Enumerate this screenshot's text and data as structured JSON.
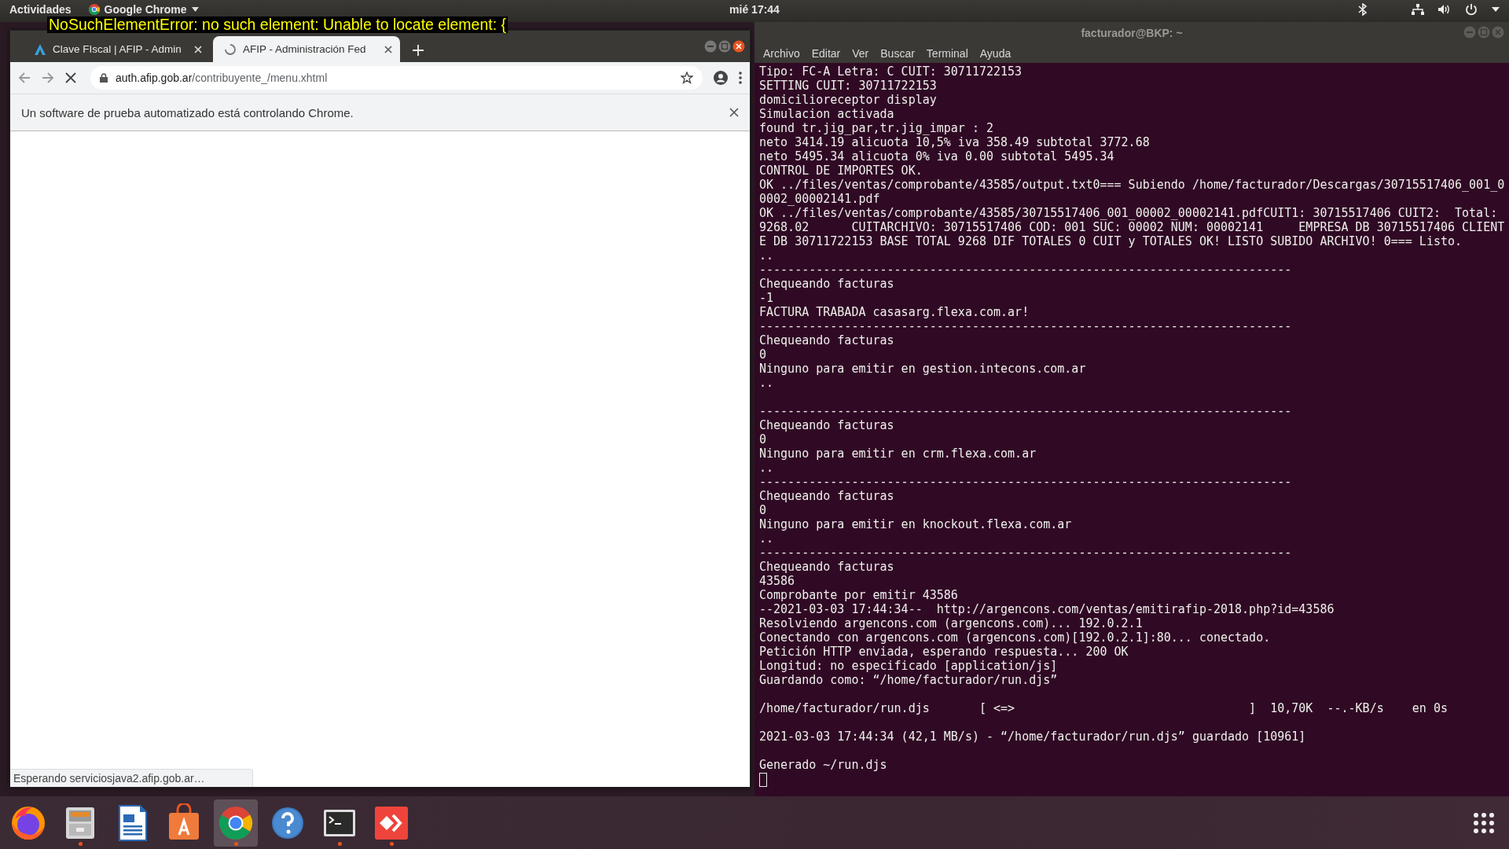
{
  "top_bar": {
    "activities": "Actividades",
    "app_menu": "Google Chrome",
    "clock": "mié 17:44"
  },
  "overlay": {
    "text": "NoSuchElementError: no such element: Unable to locate element: {"
  },
  "browser": {
    "tabs": [
      {
        "title": "Clave FIscal | AFIP - Admin",
        "selected": false,
        "loading": false
      },
      {
        "title": "AFIP - Administración Fed",
        "selected": true,
        "loading": true
      }
    ],
    "address": {
      "host": "auth.afip.gob.ar",
      "path": "/contribuyente_/menu.xhtml"
    },
    "infobar": "Un software de prueba automatizado está controlando Chrome.",
    "status": "Esperando serviciosjava2.afip.gob.ar…"
  },
  "terminal": {
    "title": "facturador@BKP: ~",
    "menu": [
      "Archivo",
      "Editar",
      "Ver",
      "Buscar",
      "Terminal",
      "Ayuda"
    ],
    "blocks": [
      {
        "lines": [
          "Tipo: FC-A Letra: C CUIT: 30711722153",
          "SETTING CUIT: 30711722153",
          "domicilioreceptor display",
          "Simulacion activada",
          "found tr.jig_par,tr.jig_impar : 2",
          "neto 3414.19 alicuota 10,5% iva 358.49 subtotal 3772.68",
          "neto 5495.34 alicuota 0% iva 0.00 subtotal 5495.34",
          "CONTROL DE IMPORTES OK.",
          "OK ../files/ventas/comprobante/43585/output.txt0=== Subiendo /home/facturador/Descargas/30715517406_001_0",
          "0002_00002141.pdf",
          "OK ../files/ventas/comprobante/43585/30715517406_001_00002_00002141.pdfCUIT1: 30715517406 CUIT2:  Total:",
          "9268.02      CUITARCHIVO: 30715517406 COD: 001 SUC: 00002 NUM: 00002141     EMPRESA DB 30715517406 CLIENT",
          "E DB 30711722153 BASE TOTAL 9268 DIF TOTALES 0 CUIT y TOTALES OK! LISTO SUBIDO ARCHIVO! 0=== Listo.",
          "..",
          "---------------------------------------------------------------------------",
          "Chequeando facturas",
          "-1",
          "FACTURA TRABADA casasarg.flexa.com.ar!",
          "---------------------------------------------------------------------------",
          "Chequeando facturas",
          "0",
          "Ninguno para emitir en gestion.intecons.com.ar",
          ".."
        ]
      },
      {
        "lines": [
          "---------------------------------------------------------------------------",
          "Chequeando facturas",
          "0",
          "Ninguno para emitir en crm.flexa.com.ar",
          "..",
          "---------------------------------------------------------------------------",
          "Chequeando facturas",
          "0",
          "Ninguno para emitir en knockout.flexa.com.ar",
          "..",
          "---------------------------------------------------------------------------",
          "Chequeando facturas",
          "43586",
          "Comprobante por emitir 43586",
          "--2021-03-03 17:44:34--  http://argencons.com/ventas/emitirafip-2018.php?id=43586",
          "Resolviendo argencons.com (argencons.com)... 192.0.2.1",
          "Conectando con argencons.com (argencons.com)[192.0.2.1]:80... conectado.",
          "Petición HTTP enviada, esperando respuesta... 200 OK",
          "Longitud: no especificado [application/js]",
          "Guardando como: “/home/facturador/run.djs”"
        ]
      },
      {
        "lines": [
          "/home/facturador/run.djs       [ <=>                                 ]  10,70K  --.-KB/s    en 0s"
        ]
      },
      {
        "lines": [
          "2021-03-03 17:44:34 (42,1 MB/s) - “/home/facturador/run.djs” guardado [10961]"
        ]
      },
      {
        "lines": [
          "Generado ~/run.djs"
        ]
      }
    ]
  },
  "dock": {
    "items": [
      {
        "running": false,
        "selected": false
      },
      {
        "running": true,
        "selected": false
      },
      {
        "running": false,
        "selected": false
      },
      {
        "running": false,
        "selected": false
      },
      {
        "running": true,
        "selected": true
      },
      {
        "running": false,
        "selected": false
      },
      {
        "running": true,
        "selected": false
      },
      {
        "running": true,
        "selected": false
      }
    ]
  }
}
